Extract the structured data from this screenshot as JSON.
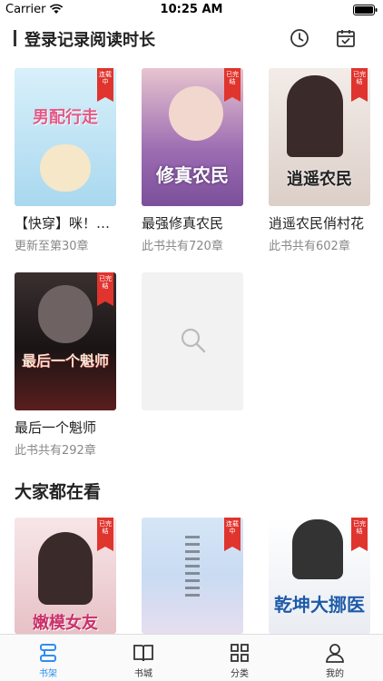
{
  "status_bar": {
    "carrier": "Carrier",
    "time": "10:25 AM"
  },
  "header": {
    "title": "登录记录阅读时长",
    "icons": [
      "clock-icon",
      "calendar-check-icon"
    ]
  },
  "shelf": [
    {
      "title": "【快穿】咪！…",
      "subtitle": "更新至第30章",
      "badge": "连载中",
      "cover_text": "男配行走",
      "cover_color": "#bfe3f4"
    },
    {
      "title": "最强修真农民",
      "subtitle": "此书共有720章",
      "badge": "已完结",
      "cover_text": "修真农民",
      "cover_color": "#a476b8"
    },
    {
      "title": "逍遥农民俏村花",
      "subtitle": "此书共有602章",
      "badge": "已完结",
      "cover_text": "逍遥农民",
      "cover_color": "#e8ded8"
    },
    {
      "title": "最后一个魁师",
      "subtitle": "此书共有292章",
      "badge": "已完结",
      "cover_text": "最后一个魁师",
      "cover_color": "#2a1e1e"
    }
  ],
  "empty_slot_icon": "search-icon",
  "section": {
    "title": "大家都在看"
  },
  "recommend": [
    {
      "badge": "已完结",
      "cover_text": "嫩模女友",
      "cover_color": "#efd4d8"
    },
    {
      "badge": "连载中",
      "cover_text": "",
      "cover_color": "#cfe2f5"
    },
    {
      "badge": "已完结",
      "cover_text": "乾坤大挪医",
      "cover_color": "#f1f2f5"
    }
  ],
  "tabs": [
    {
      "label": "书架",
      "icon": "bookshelf-icon",
      "active": true
    },
    {
      "label": "书城",
      "icon": "open-book-icon",
      "active": false
    },
    {
      "label": "分类",
      "icon": "grid-icon",
      "active": false
    },
    {
      "label": "我的",
      "icon": "person-icon",
      "active": false
    }
  ],
  "colors": {
    "accent": "#2f8ef0",
    "badge": "#e0342e"
  }
}
